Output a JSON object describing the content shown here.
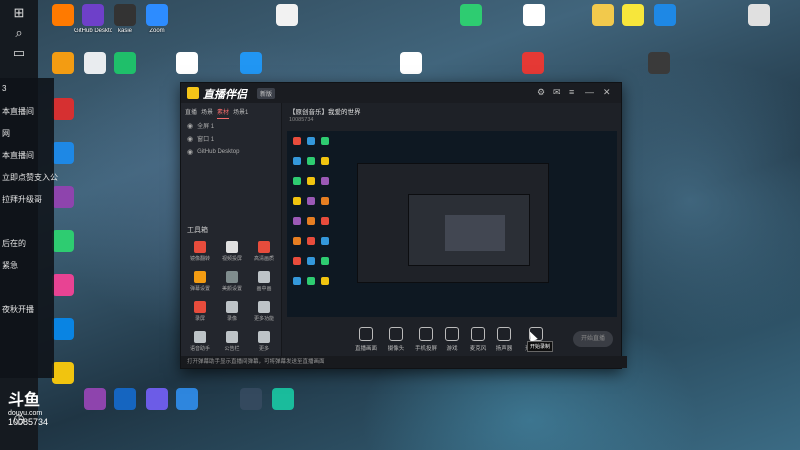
{
  "desktop": {
    "icons_row1": [
      {
        "label": "",
        "color": "#ff7a00"
      },
      {
        "label": "GitHub Desktop",
        "color": "#6e40c9"
      },
      {
        "label": "kasie",
        "color": "#333333"
      },
      {
        "label": "Zoom",
        "color": "#2d8cff"
      },
      {
        "label": "",
        "color": "#f2f2f2"
      },
      {
        "label": "",
        "color": "#2ecc71"
      },
      {
        "label": "",
        "color": "#ffffff"
      },
      {
        "label": "",
        "color": "#f2c94c"
      },
      {
        "label": "",
        "color": "#f7e63b"
      },
      {
        "label": "",
        "color": "#1e88e5"
      },
      {
        "label": "",
        "color": "#e0e0e0"
      }
    ],
    "icons_row2": [
      {
        "label": "",
        "color": "#f39c12"
      },
      {
        "label": "",
        "color": "#e9ecef"
      },
      {
        "label": "",
        "color": "#1fbf6a"
      },
      {
        "label": "",
        "color": "#ffffff"
      },
      {
        "label": "",
        "color": "#2196f3"
      },
      {
        "label": "",
        "color": "#ffffff"
      },
      {
        "label": "",
        "color": "#e53935"
      },
      {
        "label": "",
        "color": "#3a3a3a"
      }
    ],
    "icons_left_col": [
      {
        "label": "",
        "color": "#d63031"
      },
      {
        "label": "",
        "color": "#1e88e5"
      },
      {
        "label": "",
        "color": "#8e44ad"
      },
      {
        "label": "",
        "color": "#2ecc71"
      },
      {
        "label": "",
        "color": "#e84393"
      },
      {
        "label": "",
        "color": "#0984e3"
      },
      {
        "label": "",
        "color": "#f1c40f"
      }
    ],
    "icons_bottom": [
      {
        "label": "",
        "color": "#8e44ad"
      },
      {
        "label": "",
        "color": "#1565c0"
      },
      {
        "label": "",
        "color": "#6c5ce7"
      },
      {
        "label": "",
        "color": "#2e86de"
      },
      {
        "label": "",
        "color": "#34495e"
      },
      {
        "label": "",
        "color": "#1abc9c"
      }
    ]
  },
  "sidepanel": {
    "items": [
      "3",
      "本直播间",
      "网",
      "本直播间",
      "立即点赞支入公",
      "拉拜升级哥",
      "",
      "后在的",
      "紧急",
      "",
      "夜秋开播"
    ]
  },
  "watermark": {
    "logo": "斗鱼",
    "sub": "douyu.com",
    "room_id": "10085734"
  },
  "app": {
    "name": "直播伴侣",
    "badge": "新版",
    "left_tabs": [
      "直播",
      "场景",
      "素材",
      "场景1"
    ],
    "active_tab_index": 2,
    "sources": [
      "全屏 1",
      "窗口 1",
      "GitHub Desktop"
    ],
    "tools_header": "工具箱",
    "tools": [
      {
        "label": "镜像翻转",
        "color": "#e74c3c"
      },
      {
        "label": "视频投屏",
        "color": "#e0e0e0"
      },
      {
        "label": "高清画质",
        "color": "#e74c3c"
      },
      {
        "label": "弹幕设置",
        "color": "#f39c12"
      },
      {
        "label": "美颜设置",
        "color": "#7f8c8d"
      },
      {
        "label": "画中画",
        "color": "#bdc3c7"
      },
      {
        "label": "录屏",
        "color": "#e74c3c"
      },
      {
        "label": "录像",
        "color": "#bdc3c7"
      },
      {
        "label": "更多功能",
        "color": "#bdc3c7"
      },
      {
        "label": "语音助手",
        "color": "#bdc3c7"
      },
      {
        "label": "公告栏",
        "color": "#bdc3c7"
      },
      {
        "label": "更多",
        "color": "#bdc3c7"
      }
    ],
    "room_title": "【原创音乐】我爱的世界",
    "room_meta": "10085734",
    "controls": [
      {
        "label": "直播画面"
      },
      {
        "label": "摄像头"
      },
      {
        "label": "手机投屏"
      },
      {
        "label": "游戏"
      },
      {
        "label": "麦克风"
      },
      {
        "label": "扬声器"
      },
      {
        "label": "开始录制"
      }
    ],
    "start_button": "开始直播",
    "status_text": "打开弹幕助手显示直播间弹幕，可将弹幕发送至直播画面",
    "tooltip": "开始录制"
  },
  "colors": {
    "accent": "#f46b6b",
    "window_bg": "#1e2127",
    "taskbar": "#151a20"
  }
}
